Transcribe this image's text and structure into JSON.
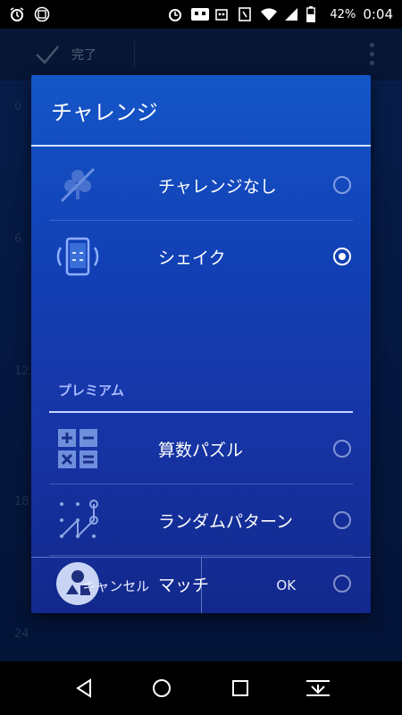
{
  "status_bar": {
    "battery_percent": "42%",
    "time": "0:04"
  },
  "background_app": {
    "toolbar": {
      "done_label": "完了"
    },
    "hour_labels": [
      "0",
      "6",
      "12",
      "18",
      "24"
    ]
  },
  "dialog": {
    "title": "チャレンジ",
    "items": [
      {
        "label": "チャレンジなし",
        "icon": "no-challenge-icon",
        "selected": false
      },
      {
        "label": "シェイク",
        "icon": "shake-phone-icon",
        "selected": true
      }
    ],
    "premium_header": "プレミアム",
    "premium_items": [
      {
        "label": "算数パズル",
        "icon": "math-puzzle-icon",
        "selected": false
      },
      {
        "label": "ランダムパターン",
        "icon": "random-pattern-icon",
        "selected": false
      },
      {
        "label": "マッチ",
        "icon": "match-shapes-icon",
        "selected": false
      }
    ],
    "buttons": {
      "cancel": "キャンセル",
      "ok": "OK"
    }
  },
  "colors": {
    "dialog_top": "#1456c8",
    "dialog_bottom": "#12288c",
    "radio_checked": "#ffffff",
    "section_header": "#a8b8ff"
  }
}
